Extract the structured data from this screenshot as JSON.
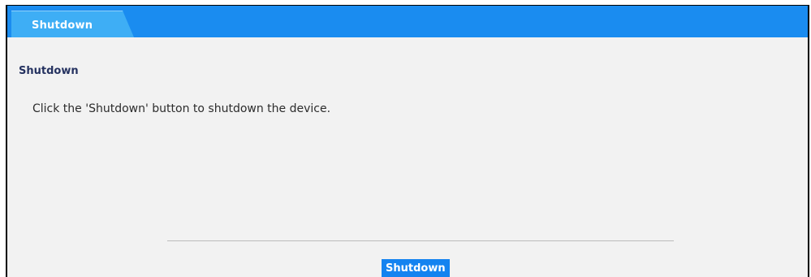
{
  "tabs": [
    {
      "label": "Shutdown",
      "active": true
    }
  ],
  "section": {
    "title": "Shutdown",
    "description": "Click the 'Shutdown' button to shutdown the device."
  },
  "actions": {
    "shutdown_label": "Shutdown"
  },
  "colors": {
    "tab_bar": "#1a8cf0",
    "active_tab": "#3eaef5",
    "button": "#1483f0",
    "panel_background": "#f2f2f2",
    "title_text": "#253260"
  }
}
